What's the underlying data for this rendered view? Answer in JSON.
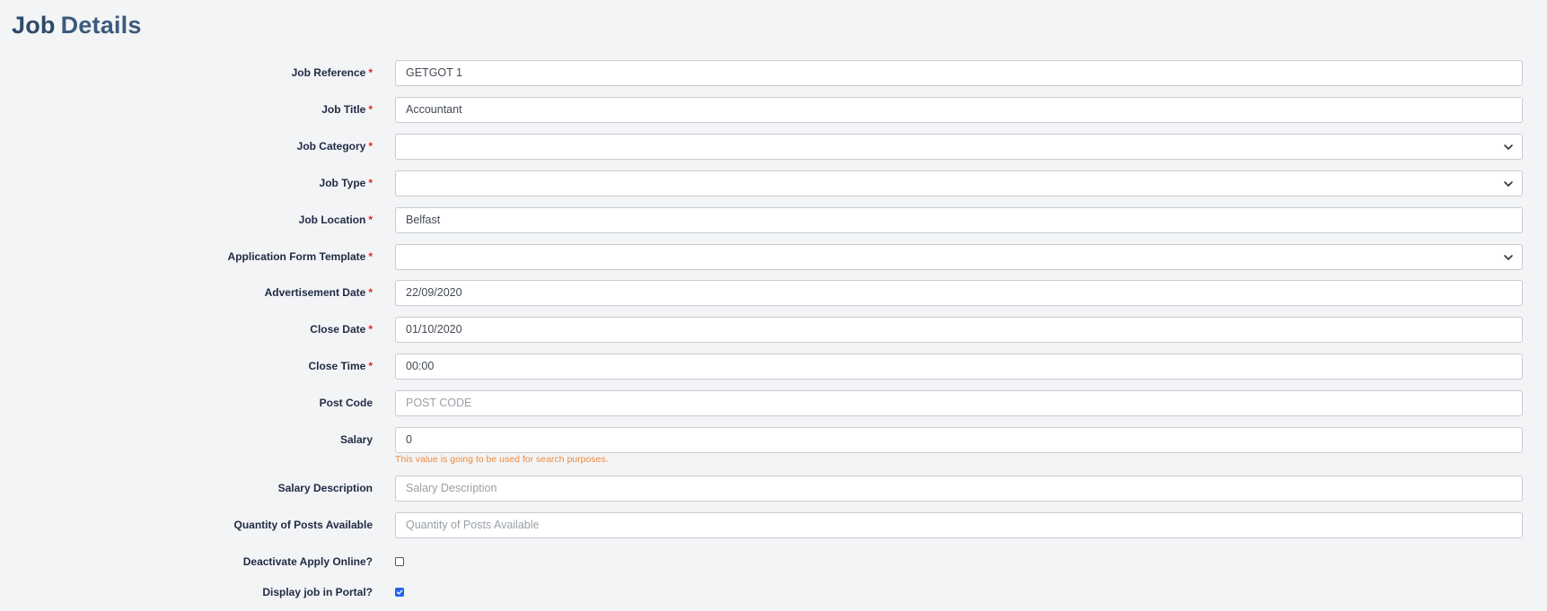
{
  "header": {
    "title_part1": "Job",
    "title_part2": "Details"
  },
  "form": {
    "required_mark": "*",
    "job_reference": {
      "label": "Job Reference",
      "value": "GETGOT 1"
    },
    "job_title": {
      "label": "Job Title",
      "value": "Accountant"
    },
    "job_category": {
      "label": "Job Category",
      "value": ""
    },
    "job_type": {
      "label": "Job Type",
      "value": ""
    },
    "job_location": {
      "label": "Job Location",
      "value": "Belfast"
    },
    "application_form_template": {
      "label": "Application Form Template",
      "value": ""
    },
    "advertisement_date": {
      "label": "Advertisement Date",
      "value": "22/09/2020"
    },
    "close_date": {
      "label": "Close Date",
      "value": "01/10/2020"
    },
    "close_time": {
      "label": "Close Time",
      "value": "00:00"
    },
    "post_code": {
      "label": "Post Code",
      "placeholder": "POST CODE"
    },
    "salary": {
      "label": "Salary",
      "value": "0",
      "hint": "This value is going to be used for search purposes."
    },
    "salary_description": {
      "label": "Salary Description",
      "placeholder": "Salary Description"
    },
    "quantity_posts": {
      "label": "Quantity of Posts Available",
      "placeholder": "Quantity of Posts Available"
    },
    "deactivate_apply_online": {
      "label": "Deactivate Apply Online?",
      "checked": false
    },
    "display_in_portal": {
      "label": "Display job in Portal?",
      "checked": true
    }
  },
  "icons": {
    "select_arrow": "chevron-down-icon",
    "checkmark": "check-icon"
  },
  "colors": {
    "title": "#2e4a6a",
    "required": "#e02424",
    "hint": "#f08a3c",
    "checkbox_checked": "#2563eb"
  }
}
